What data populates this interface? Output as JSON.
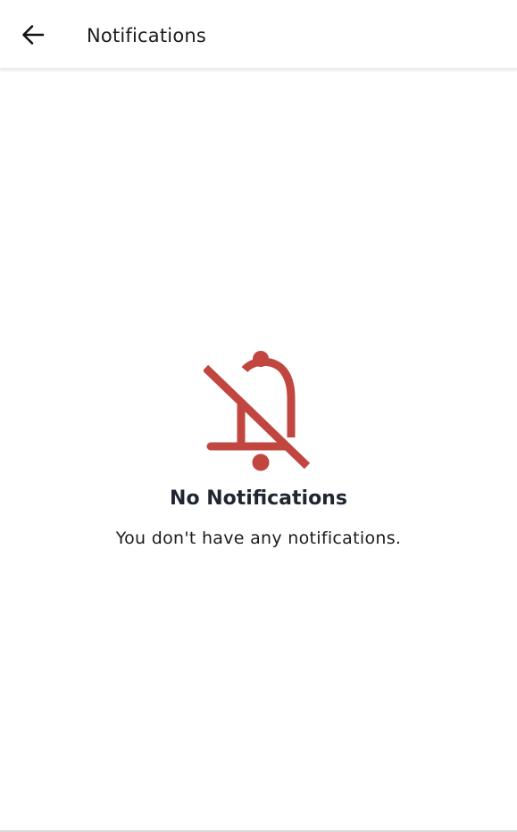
{
  "header": {
    "title": "Notifications",
    "back_icon": "arrow-left-icon"
  },
  "empty_state": {
    "icon": "bell-off-icon",
    "icon_color": "#c0463f",
    "title": "No Notifications",
    "message": "You don't have any notifications."
  }
}
